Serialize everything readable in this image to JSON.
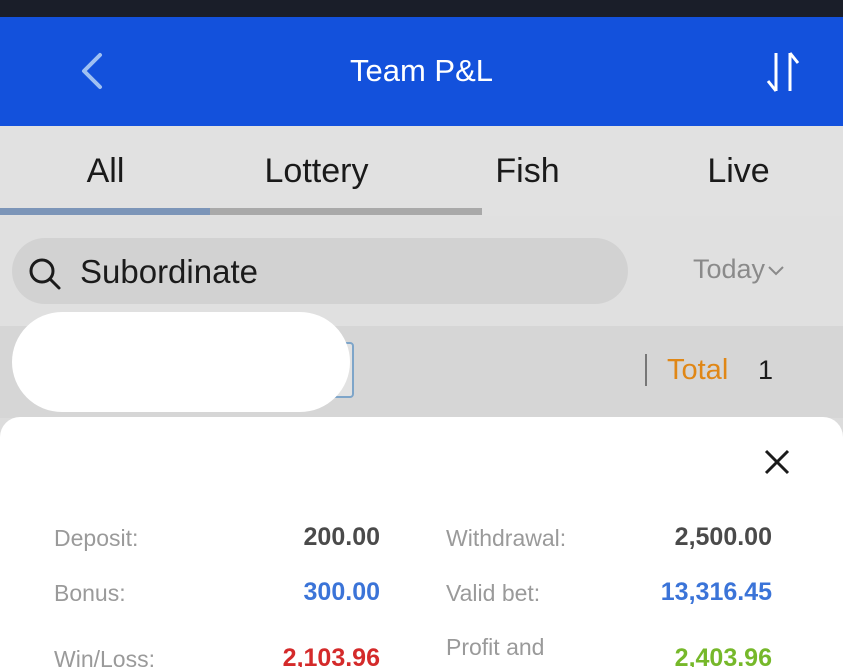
{
  "header": {
    "title": "Team P&L",
    "back_icon": "chevron-left-icon",
    "sort_icon": "sort-arrows-icon"
  },
  "tabs": [
    {
      "label": "All",
      "active": true
    },
    {
      "label": "Lottery",
      "active": false
    },
    {
      "label": "Fish",
      "active": false
    },
    {
      "label": "Live",
      "active": false
    }
  ],
  "search": {
    "icon": "search-icon",
    "placeholder": "Subordinate"
  },
  "date_filter": {
    "label": "Today"
  },
  "summary": {
    "total_label": "Total",
    "total_value": "1"
  },
  "stats": {
    "deposit_label": "Deposit:",
    "deposit_value": "200.00",
    "withdrawal_label": "Withdrawal:",
    "withdrawal_value": "2,500.00",
    "bonus_label": "Bonus:",
    "bonus_value": "300.00",
    "valid_bet_label": "Valid bet:",
    "valid_bet_value": "13,316.45",
    "winloss_label": "Win/Loss:",
    "winloss_value": "2,103.96",
    "profit_label": "Profit and",
    "profit_value": "2,403.96"
  },
  "colors": {
    "header_bg": "#1351dc",
    "accent_orange": "#e08716",
    "value_blue": "#3b74d8",
    "value_red": "#d42a2a",
    "value_green": "#76b82a",
    "value_dark": "#4a4a4a"
  }
}
